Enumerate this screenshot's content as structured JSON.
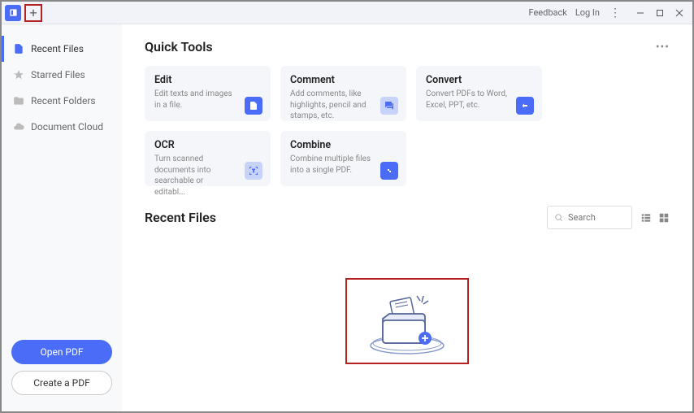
{
  "titlebar": {
    "feedback": "Feedback",
    "login": "Log In"
  },
  "sidebar": {
    "items": [
      {
        "label": "Recent Files"
      },
      {
        "label": "Starred Files"
      },
      {
        "label": "Recent Folders"
      },
      {
        "label": "Document Cloud"
      }
    ],
    "open_pdf": "Open PDF",
    "create_pdf": "Create a PDF"
  },
  "quicktools": {
    "title": "Quick Tools",
    "cards": [
      {
        "title": "Edit",
        "desc": "Edit texts and images in a file."
      },
      {
        "title": "Comment",
        "desc": "Add comments, like highlights, pencil and stamps, etc."
      },
      {
        "title": "Convert",
        "desc": "Convert PDFs to Word, Excel, PPT, etc."
      },
      {
        "title": "OCR",
        "desc": "Turn scanned documents into searchable or editabl..."
      },
      {
        "title": "Combine",
        "desc": "Combine multiple files into a single PDF."
      }
    ]
  },
  "recent": {
    "title": "Recent Files",
    "search_placeholder": "Search"
  }
}
